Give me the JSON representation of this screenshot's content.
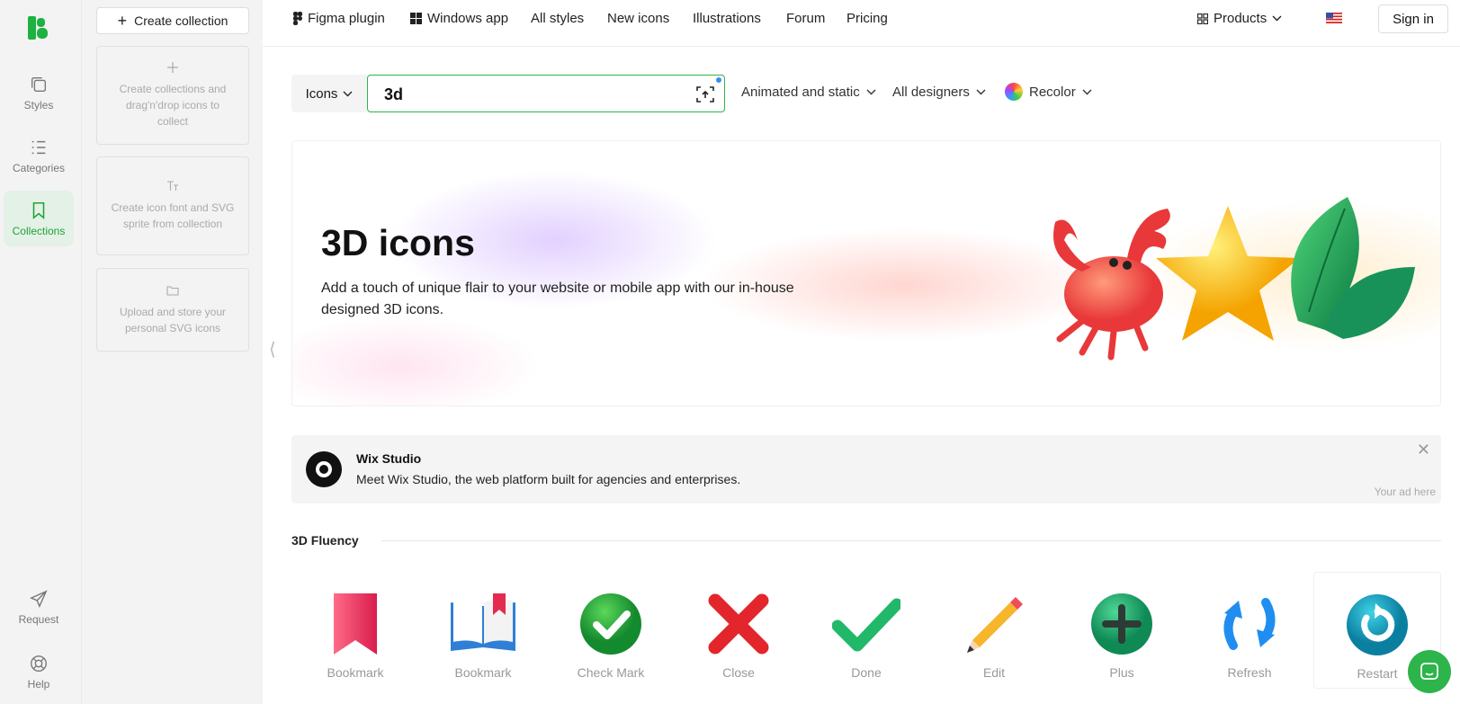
{
  "rail": {
    "items": [
      {
        "label": "Styles",
        "icon": "styles-icon"
      },
      {
        "label": "Categories",
        "icon": "categories-icon"
      },
      {
        "label": "Collections",
        "icon": "bookmark-icon",
        "active": true
      },
      {
        "label": "Request",
        "icon": "send-icon"
      },
      {
        "label": "Help",
        "icon": "lifebuoy-icon"
      }
    ]
  },
  "collections_panel": {
    "create_label": "Create collection",
    "cards": [
      {
        "icon": "plus-icon",
        "text": "Create collections and drag'n'drop icons to collect"
      },
      {
        "icon": "font-icon",
        "text": "Create icon font and SVG sprite from collection"
      },
      {
        "icon": "folder-icon",
        "text": "Upload and store your personal SVG icons"
      }
    ],
    "collapse_glyph": "⟨"
  },
  "nav": {
    "links": [
      "Figma plugin",
      "Windows app",
      "All styles",
      "New icons",
      "Illustrations",
      "Forum",
      "Pricing"
    ],
    "products": "Products",
    "signin": "Sign in"
  },
  "search": {
    "type": "Icons",
    "query": "3d",
    "filters": [
      "Animated and static",
      "All designers",
      "Recolor"
    ]
  },
  "hero": {
    "title": "3D icons",
    "description": "Add a touch of unique flair to your website or mobile app with our in-house designed 3D icons."
  },
  "ad": {
    "title": "Wix Studio",
    "text": "Meet Wix Studio, the web platform built for agencies and enterprises.",
    "note": "Your ad here",
    "close": "✕"
  },
  "section": {
    "title": "3D Fluency",
    "icons": [
      {
        "label": "Bookmark",
        "icon": "bookmark-3d-icon"
      },
      {
        "label": "Bookmark",
        "icon": "open-book-3d-icon"
      },
      {
        "label": "Check Mark",
        "icon": "check-mark-3d-icon"
      },
      {
        "label": "Close",
        "icon": "close-3d-icon"
      },
      {
        "label": "Done",
        "icon": "done-3d-icon"
      },
      {
        "label": "Edit",
        "icon": "pencil-3d-icon"
      },
      {
        "label": "Plus",
        "icon": "plus-3d-icon"
      },
      {
        "label": "Refresh",
        "icon": "refresh-3d-icon"
      },
      {
        "label": "Restart",
        "icon": "restart-3d-icon"
      }
    ]
  },
  "colors": {
    "accent": "#2db44a",
    "rail_bg": "#f3f3f3"
  }
}
